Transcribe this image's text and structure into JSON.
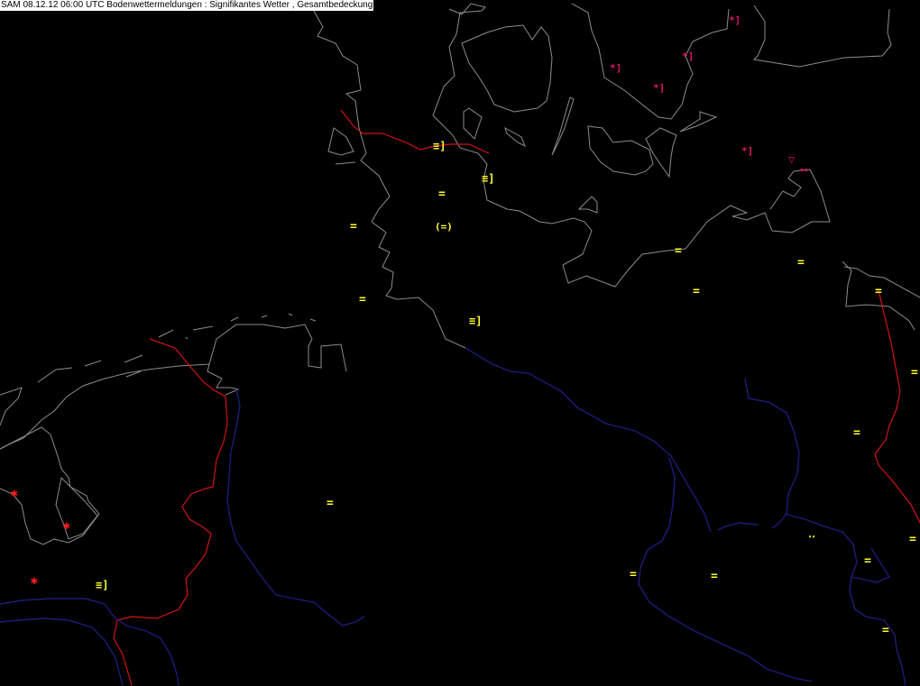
{
  "header": {
    "title": "SAM 08.12.12 06:00 UTC  Bodenwettermeldungen :  Signifikantes Wetter , Gesamtbedeckung"
  },
  "colors": {
    "background": "#000000",
    "coastline": "#8c8c8c",
    "border_red": "#d21414",
    "river_blue": "#1c1c78",
    "fog_symbol": "#ffff30",
    "snow_symbol": "#e0106a",
    "snow_red": "#ff1a1a",
    "title_bg": "#ffffff",
    "title_fg": "#000000"
  },
  "weather_symbols": [
    {
      "kind": "fog",
      "glyph": "="
    },
    {
      "kind": "fog",
      "glyph": "="
    },
    {
      "kind": "fog",
      "glyph": "="
    },
    {
      "kind": "fog",
      "glyph": "="
    },
    {
      "kind": "fog",
      "glyph": "="
    },
    {
      "kind": "fog",
      "glyph": "="
    },
    {
      "kind": "fog",
      "glyph": "="
    },
    {
      "kind": "fog",
      "glyph": "="
    },
    {
      "kind": "fog",
      "glyph": "="
    },
    {
      "kind": "fog",
      "glyph": "="
    },
    {
      "kind": "fog",
      "glyph": "="
    },
    {
      "kind": "fog",
      "glyph": "="
    },
    {
      "kind": "fog",
      "glyph": "="
    },
    {
      "kind": "fog",
      "glyph": "="
    },
    {
      "kind": "fog",
      "glyph": "="
    },
    {
      "kind": "fog-past-hour",
      "glyph": "(=)"
    },
    {
      "kind": "fog-thickening",
      "glyph": "≡]"
    },
    {
      "kind": "fog-thickening",
      "glyph": "≡]"
    },
    {
      "kind": "fog-thickening",
      "glyph": "≡]"
    },
    {
      "kind": "fog-thickening",
      "glyph": "≡]"
    },
    {
      "kind": "drizzle-dots",
      "glyph": "‥"
    },
    {
      "kind": "snow-past-hour",
      "glyph": "*]"
    },
    {
      "kind": "snow-past-hour",
      "glyph": "*]"
    },
    {
      "kind": "snow-past-hour",
      "glyph": "*]"
    },
    {
      "kind": "snow-past-hour",
      "glyph": "*]"
    },
    {
      "kind": "snow-past-hour",
      "glyph": "*]"
    },
    {
      "kind": "snow-shower",
      "glyph": "▽"
    },
    {
      "kind": "snow-continuous",
      "glyph": "**"
    },
    {
      "kind": "snow-asterisk",
      "glyph": "✱"
    },
    {
      "kind": "snow-asterisk",
      "glyph": "✱"
    },
    {
      "kind": "snow-asterisk",
      "glyph": "✱"
    }
  ]
}
